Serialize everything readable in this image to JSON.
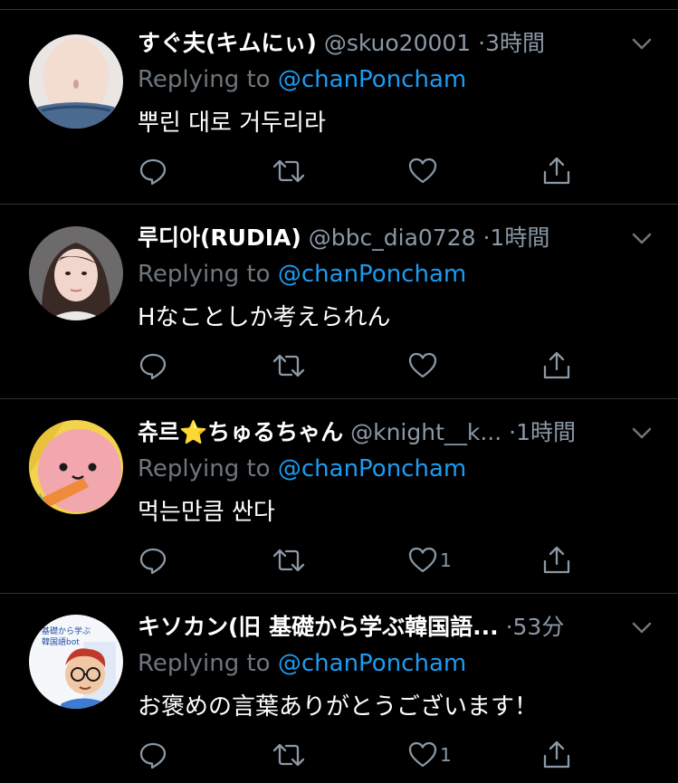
{
  "tweets": [
    {
      "display_name": "すぐ夫(キムにぃ)",
      "handle": "@skuo20001",
      "separator": "·",
      "time": "3時間",
      "replying_prefix": "Replying to",
      "replying_to": "@chanPoncham",
      "text": "뿌린 대로 거두리라",
      "likes": "",
      "avatar_icon": "avatar-photo-midriff"
    },
    {
      "display_name": "루디아(RUDIA)",
      "handle": "@bbc_dia0728",
      "separator": "·",
      "time": "1時間",
      "replying_prefix": "Replying to",
      "replying_to": "@chanPoncham",
      "text": "Hなことしか考えられん",
      "likes": "",
      "avatar_icon": "avatar-photo-portrait"
    },
    {
      "display_name": "츄르⭐ちゅるちゃん",
      "handle": "@knight__k...",
      "separator": "·",
      "time": "1時間",
      "replying_prefix": "Replying to",
      "replying_to": "@chanPoncham",
      "text": "먹는만큼 싼다",
      "likes": "1",
      "avatar_icon": "avatar-pink-character"
    },
    {
      "display_name": "キソカン(旧 基礎から学ぶ韓国語...",
      "handle": "",
      "separator": "·",
      "time": "53分",
      "replying_prefix": "Replying to",
      "replying_to": "@chanPoncham",
      "text": "お褒めの言葉ありがとうございます！",
      "likes": "1",
      "avatar_icon": "avatar-illustration",
      "avatar_text_line1": "基礎から学ぶ",
      "avatar_text_line2": "韓国語bot"
    }
  ],
  "colors": {
    "background": "#000000",
    "primary_text": "#ffffff",
    "secondary_text": "#8b98a5",
    "mention": "#1d9bf0",
    "divider": "#2f3336"
  }
}
